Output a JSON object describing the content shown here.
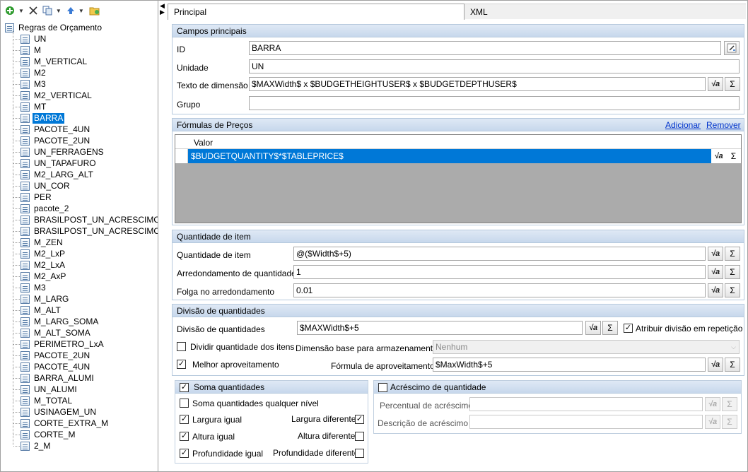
{
  "tree": {
    "root": "Regras de Orçamento",
    "items": [
      "UN",
      "M",
      "M_VERTICAL",
      "M2",
      "M3",
      "M2_VERTICAL",
      "MT",
      "BARRA",
      "PACOTE_4UN",
      "PACOTE_2UN",
      "UN_FERRAGENS",
      "UN_TAPAFURO",
      "M2_LARG_ALT",
      "UN_COR",
      "PER",
      "pacote_2",
      "BRASILPOST_UN_ACRESCIMO",
      "BRASILPOST_UN_ACRESCIMO_V",
      "M_ZEN",
      "M2_LxP",
      "M2_LxA",
      "M2_AxP",
      "M3",
      "M_LARG",
      "M_ALT",
      "M_LARG_SOMA",
      "M_ALT_SOMA",
      "PERIMETRO_LxA",
      "PACOTE_2UN",
      "PACOTE_4UN",
      "BARRA_ALUMI",
      "UN_ALUMI",
      "M_TOTAL",
      "USINAGEM_UN",
      "CORTE_EXTRA_M",
      "CORTE_M",
      "2_M"
    ],
    "selected": "BARRA"
  },
  "tabs": {
    "principal": "Principal",
    "xml": "XML"
  },
  "campos": {
    "title": "Campos principais",
    "id_label": "ID",
    "id_value": "BARRA",
    "unidade_label": "Unidade",
    "unidade_value": "UN",
    "texto_label": "Texto de dimensão",
    "texto_value": "$MAXWidth$ x $BUDGETHEIGHTUSER$ x $BUDGETDEPTHUSER$",
    "grupo_label": "Grupo",
    "grupo_value": ""
  },
  "formulas": {
    "title": "Fórmulas de Preços",
    "add": "Adicionar",
    "remove": "Remover",
    "col": "Valor",
    "row": "$BUDGETQUANTITY$*$TABLEPRICE$"
  },
  "quantidade": {
    "title": "Quantidade de item",
    "qtd_label": "Quantidade de item",
    "qtd_value": "@($Width$+5)",
    "arred_label": "Arredondamento de quantidade",
    "arred_value": "1",
    "folga_label": "Folga no arredondamento",
    "folga_value": "0.01"
  },
  "divisao": {
    "title": "Divisão de quantidades",
    "div_label": "Divisão de quantidades",
    "div_value": "$MAXWidth$+5",
    "atribuir": "Atribuir divisão em repetição",
    "dividir": "Dividir quantidade dos itens",
    "dim_label": "Dimensão base para armazenamento",
    "dim_value": "Nenhum",
    "melhor": "Melhor aproveitamento",
    "form_label": "Fórmula de aproveitamento",
    "form_value": "$MaxWidth$+5"
  },
  "soma": {
    "title": "Soma quantidades",
    "qualquer": "Soma quantidades qualquer nível",
    "larg_igual": "Largura igual",
    "larg_dif": "Largura diferente",
    "alt_igual": "Altura igual",
    "alt_dif": "Altura diferente",
    "prof_igual": "Profundidade igual",
    "prof_dif": "Profundidade diferente"
  },
  "acrescimo": {
    "title": "Acréscimo de quantidade",
    "perc_label": "Percentual de acréscimo",
    "desc_label": "Descrição de acréscimo"
  },
  "icons": {
    "sigma": "Σ",
    "sqrt": "√a"
  }
}
